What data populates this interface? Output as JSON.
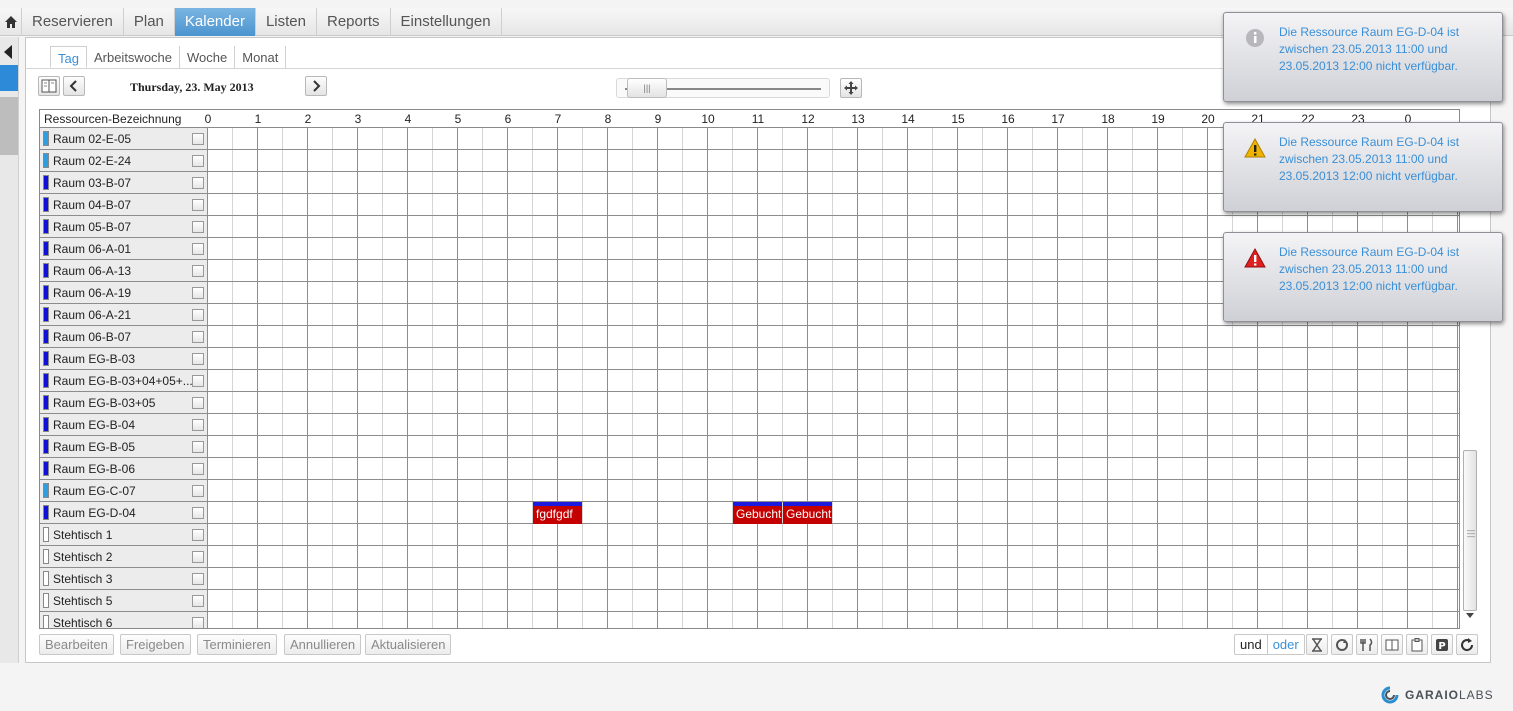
{
  "nav": {
    "home_icon": "home-icon",
    "items": [
      "Reservieren",
      "Plan",
      "Kalender",
      "Listen",
      "Reports",
      "Einstellungen"
    ],
    "active": "Kalender"
  },
  "subtabs": [
    "Tag",
    "Arbeitswoche",
    "Woche",
    "Monat"
  ],
  "subtab_active": "Tag",
  "date_label": "Thursday, 23. May 2013",
  "grid": {
    "column_header": "Ressourcen-Bezeichnung",
    "hours": [
      "0",
      "1",
      "2",
      "3",
      "4",
      "5",
      "6",
      "7",
      "8",
      "9",
      "10",
      "11",
      "12",
      "13",
      "14",
      "15",
      "16",
      "17",
      "18",
      "19",
      "20",
      "21",
      "22",
      "23",
      "0"
    ],
    "rows": [
      {
        "name": "Raum 02-E-05",
        "color": "#2f9ee0"
      },
      {
        "name": "Raum 02-E-24",
        "color": "#2f9ee0"
      },
      {
        "name": "Raum 03-B-07",
        "color": "#1010d8"
      },
      {
        "name": "Raum 04-B-07",
        "color": "#1010d8"
      },
      {
        "name": "Raum 05-B-07",
        "color": "#1010d8"
      },
      {
        "name": "Raum 06-A-01",
        "color": "#1010d8"
      },
      {
        "name": "Raum 06-A-13",
        "color": "#1010d8"
      },
      {
        "name": "Raum 06-A-19",
        "color": "#1010d8"
      },
      {
        "name": "Raum 06-A-21",
        "color": "#1010d8"
      },
      {
        "name": "Raum 06-B-07",
        "color": "#1010d8"
      },
      {
        "name": "Raum EG-B-03",
        "color": "#1010d8"
      },
      {
        "name": "Raum EG-B-03+04+05+...",
        "color": "#1010d8"
      },
      {
        "name": "Raum EG-B-03+05",
        "color": "#1010d8"
      },
      {
        "name": "Raum EG-B-04",
        "color": "#1010d8"
      },
      {
        "name": "Raum EG-B-05",
        "color": "#1010d8"
      },
      {
        "name": "Raum EG-B-06",
        "color": "#1010d8"
      },
      {
        "name": "Raum EG-C-07",
        "color": "#2f9ee0"
      },
      {
        "name": "Raum EG-D-04",
        "color": "#1010d8"
      },
      {
        "name": "Stehtisch 1",
        "color": "#ffffff"
      },
      {
        "name": "Stehtisch 2",
        "color": "#ffffff"
      },
      {
        "name": "Stehtisch 3",
        "color": "#ffffff"
      },
      {
        "name": "Stehtisch 5",
        "color": "#ffffff"
      },
      {
        "name": "Stehtisch 6",
        "color": "#ffffff"
      }
    ],
    "bookings": [
      {
        "row": 17,
        "label": "fgdfgdf",
        "start": 6.5,
        "end": 7.5
      },
      {
        "row": 17,
        "label": "Gebucht",
        "start": 10.5,
        "end": 11.5
      },
      {
        "row": 17,
        "label": "Gebucht",
        "start": 11.5,
        "end": 12.5
      }
    ]
  },
  "actions": [
    "Bearbeiten",
    "Freigeben",
    "Terminieren",
    "Annullieren",
    "Aktualisieren"
  ],
  "filter_toggle": {
    "left": "und",
    "right": "oder"
  },
  "toolbar_icons": [
    "hourglass-icon",
    "sync-icon",
    "cutlery-icon",
    "book-icon",
    "clipboard-icon",
    "parking-icon",
    "refresh-icon"
  ],
  "notifications": [
    {
      "level": "info",
      "icon": "info-icon",
      "text": "Die Ressource Raum EG-D-04 ist zwischen 23.05.2013 11:00 und 23.05.2013 12:00 nicht verfügbar."
    },
    {
      "level": "warning",
      "icon": "warning-icon",
      "text": "Die Ressource Raum EG-D-04 ist zwischen 23.05.2013 11:00 und 23.05.2013 12:00 nicht verfügbar."
    },
    {
      "level": "error",
      "icon": "error-icon",
      "text": "Die Ressource Raum EG-D-04 ist zwischen 23.05.2013 11:00 und 23.05.2013 12:00 nicht verfügbar."
    }
  ],
  "logo": {
    "part1": "GARAIO",
    "part2": "LABS"
  }
}
